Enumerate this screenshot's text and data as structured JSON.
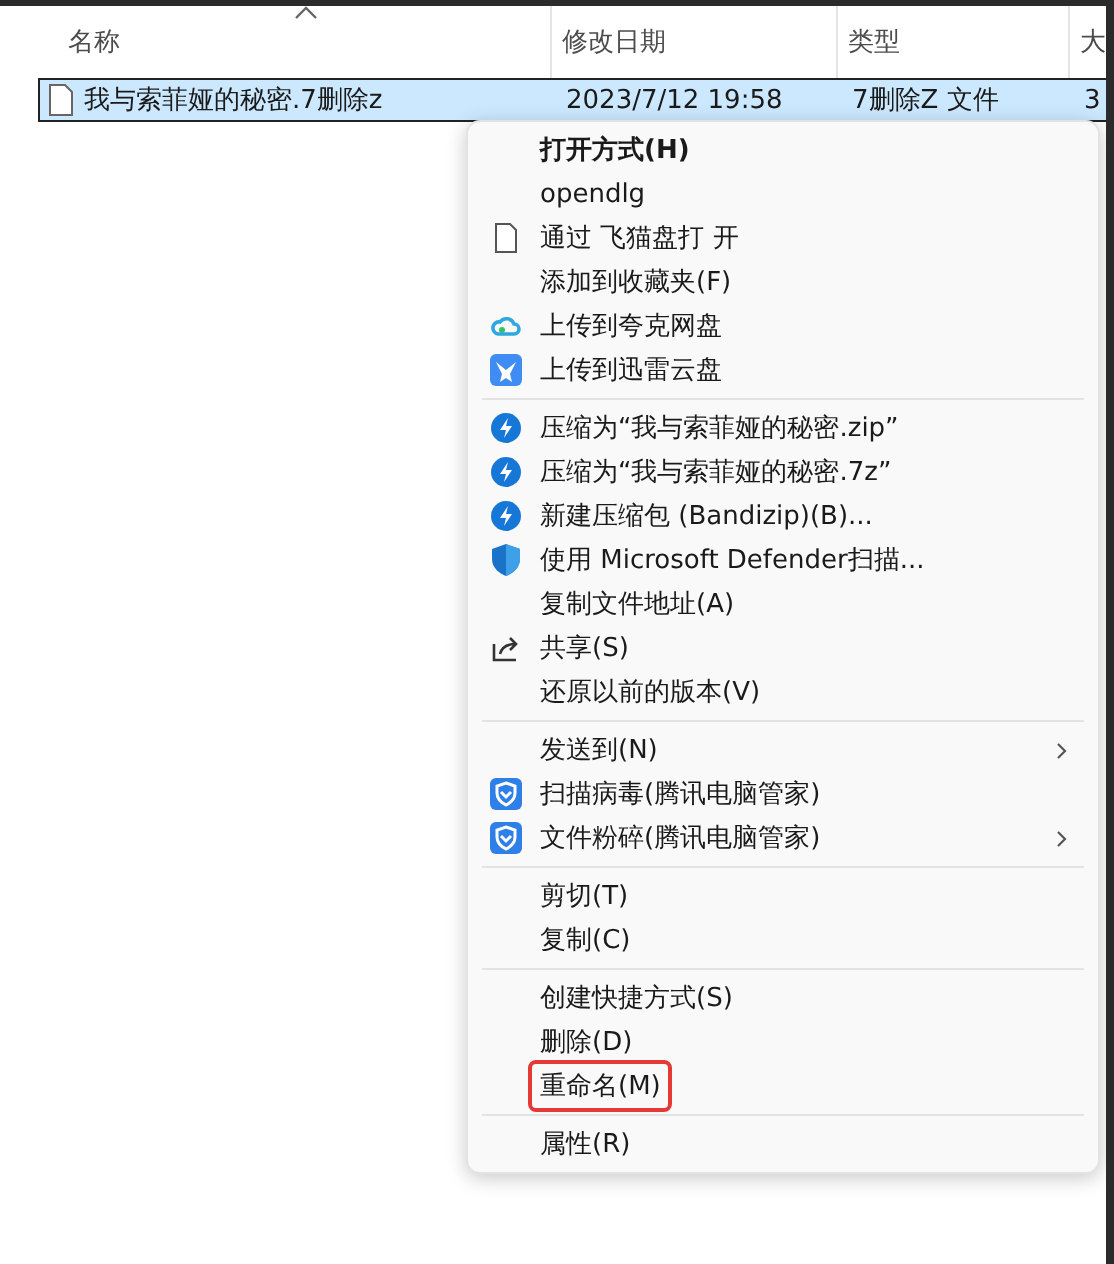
{
  "columns": [
    {
      "label": "名称",
      "sorted": true
    },
    {
      "label": "修改日期",
      "sorted": false
    },
    {
      "label": "类型",
      "sorted": false
    },
    {
      "label": "大",
      "sorted": false
    }
  ],
  "file": {
    "name": "我与索菲娅的秘密.7删除z",
    "modified": "2023/7/12 19:58",
    "type": "7删除Z 文件",
    "column_4": "3",
    "selected": true
  },
  "context_menu": {
    "groups": [
      [
        {
          "label": "打开方式(H)",
          "kind": "plain",
          "default": true,
          "submenu": false,
          "highlighted": false
        },
        {
          "label": "opendlg",
          "kind": "plain",
          "default": false,
          "submenu": false,
          "highlighted": false
        },
        {
          "label": "通过 飞猫盘打 开",
          "kind": "file",
          "default": false,
          "submenu": false,
          "highlighted": false
        },
        {
          "label": "添加到收藏夹(F)",
          "kind": "plain",
          "default": false,
          "submenu": false,
          "highlighted": false
        },
        {
          "label": "上传到夸克网盘",
          "kind": "cloud",
          "default": false,
          "submenu": false,
          "highlighted": false
        },
        {
          "label": "上传到迅雷云盘",
          "kind": "bird",
          "default": false,
          "submenu": false,
          "highlighted": false
        }
      ],
      [
        {
          "label": "压缩为“我与索菲娅的秘密.zip”",
          "kind": "bolt",
          "default": false,
          "submenu": false,
          "highlighted": false
        },
        {
          "label": "压缩为“我与索菲娅的秘密.7z”",
          "kind": "bolt",
          "default": false,
          "submenu": false,
          "highlighted": false
        },
        {
          "label": "新建压缩包 (Bandizip)(B)...",
          "kind": "bolt",
          "default": false,
          "submenu": false,
          "highlighted": false
        },
        {
          "label": "使用 Microsoft Defender扫描...",
          "kind": "shield",
          "default": false,
          "submenu": false,
          "highlighted": false
        },
        {
          "label": "复制文件地址(A)",
          "kind": "plain",
          "default": false,
          "submenu": false,
          "highlighted": false
        },
        {
          "label": "共享(S)",
          "kind": "share",
          "default": false,
          "submenu": false,
          "highlighted": false
        },
        {
          "label": "还原以前的版本(V)",
          "kind": "plain",
          "default": false,
          "submenu": false,
          "highlighted": false
        }
      ],
      [
        {
          "label": "发送到(N)",
          "kind": "plain",
          "default": false,
          "submenu": true,
          "highlighted": false
        },
        {
          "label": "扫描病毒(腾讯电脑管家)",
          "kind": "guard",
          "default": false,
          "submenu": false,
          "highlighted": false
        },
        {
          "label": "文件粉碎(腾讯电脑管家)",
          "kind": "guard",
          "default": false,
          "submenu": true,
          "highlighted": false
        }
      ],
      [
        {
          "label": "剪切(T)",
          "kind": "plain",
          "default": false,
          "submenu": false,
          "highlighted": false
        },
        {
          "label": "复制(C)",
          "kind": "plain",
          "default": false,
          "submenu": false,
          "highlighted": false
        }
      ],
      [
        {
          "label": "创建快捷方式(S)",
          "kind": "plain",
          "default": false,
          "submenu": false,
          "highlighted": false
        },
        {
          "label": "删除(D)",
          "kind": "plain",
          "default": false,
          "submenu": false,
          "highlighted": false
        },
        {
          "label": "重命名(M)",
          "kind": "plain",
          "default": false,
          "submenu": false,
          "highlighted": true
        }
      ],
      [
        {
          "label": "属性(R)",
          "kind": "plain",
          "default": false,
          "submenu": false,
          "highlighted": false
        }
      ]
    ]
  }
}
